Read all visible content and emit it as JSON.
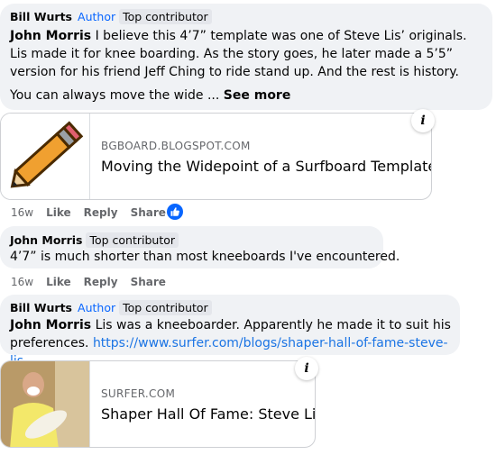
{
  "comments": [
    {
      "author": "Bill Wurts",
      "role": "Author",
      "badge": "Top contributor",
      "mention": "John Morris",
      "text": " I believe this 4’7” template was one of Steve Lis’ originals. Lis made it for knee boarding. As the story goes, he later made a 5’5” version for his friend Jeff Ching to ride stand up. And the rest is history.",
      "more_text": "You can always move the wide ... ",
      "see_more": "See more",
      "preview": {
        "domain": "BGBOARD.BLOGSPOT.COM",
        "title": "Moving the Widepoint of a Surfboard Template"
      },
      "actions": {
        "time": "16w",
        "like": "Like",
        "reply": "Reply",
        "share": "Share"
      }
    },
    {
      "author": "John Morris",
      "badge": "Top contributor",
      "text": "4’7” is much shorter than most kneeboards I've encountered.",
      "actions": {
        "time": "16w",
        "like": "Like",
        "reply": "Reply",
        "share": "Share"
      }
    },
    {
      "author": "Bill Wurts",
      "role": "Author",
      "badge": "Top contributor",
      "mention": "John Morris",
      "text": " Lis was a kneeboarder. Apparently he made it to suit his preferences. ",
      "link": "https://www.surfer.com/blogs/shaper-hall-of-fame-steve-lis",
      "preview": {
        "domain": "SURFER.COM",
        "title": "Shaper Hall Of Fame: Steve Lis"
      }
    }
  ],
  "colors": {
    "bubble": "#f0f2f5",
    "link": "#1b74e4",
    "accent": "#0866ff"
  },
  "icons": {
    "info": "info-icon",
    "like": "like-icon"
  },
  "info_glyph": "i"
}
